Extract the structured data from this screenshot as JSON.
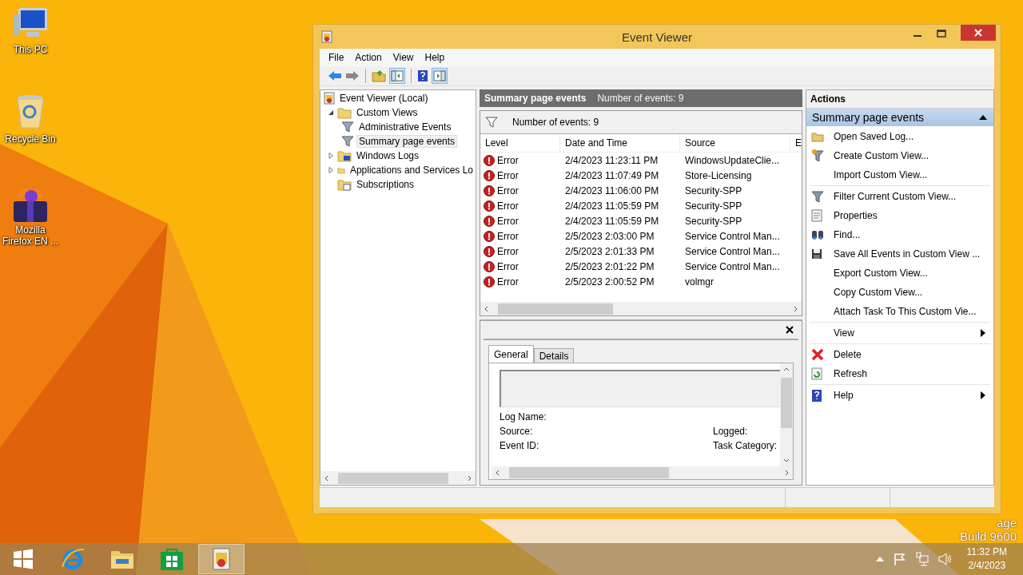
{
  "desktop_icons": [
    {
      "label": "This PC",
      "kind": "computer"
    },
    {
      "label": "Recycle Bin",
      "kind": "bin"
    },
    {
      "label": "Mozilla Firefox EN ...",
      "kind": "box"
    }
  ],
  "watermark": [
    "age",
    "Build 9600"
  ],
  "window": {
    "title": "Event Viewer",
    "menu": [
      "File",
      "Action",
      "View",
      "Help"
    ],
    "tree": [
      {
        "label": "Event Viewer (Local)",
        "kind": "root",
        "selected": false,
        "children": [
          {
            "label": "Custom Views",
            "kind": "folder",
            "selected": false,
            "expanded": true,
            "children": [
              {
                "label": "Administrative Events",
                "kind": "view",
                "selected": false
              },
              {
                "label": "Summary page events",
                "kind": "view",
                "selected": true
              }
            ]
          },
          {
            "label": "Windows Logs",
            "kind": "logs",
            "selected": false,
            "expanded": false
          },
          {
            "label": "Applications and Services Lo",
            "kind": "folder",
            "selected": false,
            "expanded": false
          },
          {
            "label": "Subscriptions",
            "kind": "subs",
            "selected": false
          }
        ]
      }
    ],
    "summary_header": {
      "title": "Summary page events",
      "count": "Number of events: 9"
    },
    "filter_bar": "Number of events: 9",
    "table": {
      "columns": [
        "Level",
        "Date and Time",
        "Source",
        "E"
      ],
      "rows": [
        {
          "level": "Error",
          "date": "2/4/2023 11:23:11 PM",
          "source": "WindowsUpdateClie..."
        },
        {
          "level": "Error",
          "date": "2/4/2023 11:07:49 PM",
          "source": "Store-Licensing"
        },
        {
          "level": "Error",
          "date": "2/4/2023 11:06:00 PM",
          "source": "Security-SPP"
        },
        {
          "level": "Error",
          "date": "2/4/2023 11:05:59 PM",
          "source": "Security-SPP"
        },
        {
          "level": "Error",
          "date": "2/4/2023 11:05:59 PM",
          "source": "Security-SPP"
        },
        {
          "level": "Error",
          "date": "2/5/2023 2:03:00 PM",
          "source": "Service Control Man..."
        },
        {
          "level": "Error",
          "date": "2/5/2023 2:01:33 PM",
          "source": "Service Control Man..."
        },
        {
          "level": "Error",
          "date": "2/5/2023 2:01:22 PM",
          "source": "Service Control Man..."
        },
        {
          "level": "Error",
          "date": "2/5/2023 2:00:52 PM",
          "source": "volmgr"
        }
      ]
    },
    "detail": {
      "tabs": [
        {
          "label": "General",
          "selected": true
        },
        {
          "label": "Details",
          "selected": false
        }
      ],
      "fields_left": [
        "Log Name:",
        "Source:",
        "Event ID:"
      ],
      "fields_right": [
        "Logged:",
        "Task Category:"
      ]
    },
    "actions": {
      "header": "Actions",
      "section": "Summary page events",
      "expanded": true,
      "groups": [
        [
          {
            "label": "Open Saved Log..."
          },
          {
            "label": "Create Custom View..."
          },
          {
            "label": "Import Custom View..."
          }
        ],
        [
          {
            "label": "Filter Current Custom View..."
          },
          {
            "label": "Properties"
          },
          {
            "label": "Find..."
          },
          {
            "label": "Save All Events in Custom View ..."
          },
          {
            "label": "Export Custom View..."
          },
          {
            "label": "Copy Custom View..."
          },
          {
            "label": "Attach Task To This Custom Vie..."
          }
        ],
        [
          {
            "label": "View",
            "submenu": true
          }
        ],
        [
          {
            "label": "Delete"
          },
          {
            "label": "Refresh"
          }
        ],
        [
          {
            "label": "Help",
            "submenu": true
          }
        ]
      ]
    }
  },
  "taskbar": {
    "apps": [
      {
        "kind": "ie",
        "active": false
      },
      {
        "kind": "explorer",
        "active": false
      },
      {
        "kind": "store",
        "active": false
      },
      {
        "kind": "eventviewer",
        "active": true
      }
    ],
    "time": "11:32 PM",
    "date": "2/4/2023"
  }
}
